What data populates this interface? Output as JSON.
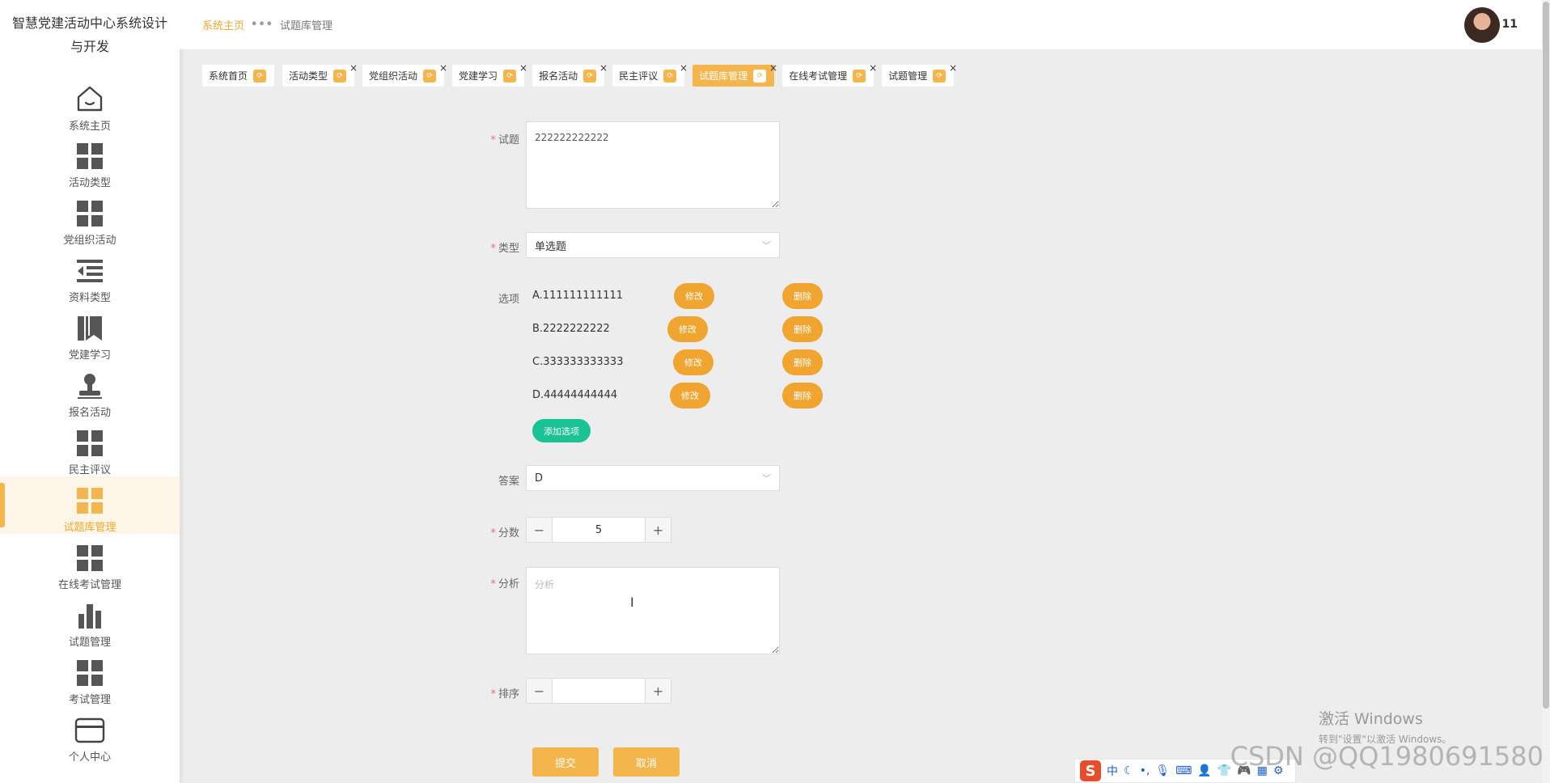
{
  "app": {
    "title": "智慧党建活动中心系统设计与开发"
  },
  "sidebar": {
    "items": [
      {
        "label": "系统主页",
        "icon": "home-icon"
      },
      {
        "label": "活动类型",
        "icon": "grid-icon"
      },
      {
        "label": "党组织活动",
        "icon": "grid-icon"
      },
      {
        "label": "资料类型",
        "icon": "indent-list-icon"
      },
      {
        "label": "党建学习",
        "icon": "book-icon"
      },
      {
        "label": "报名活动",
        "icon": "user-stamp-icon"
      },
      {
        "label": "民主评议",
        "icon": "grid-icon"
      },
      {
        "label": "试题库管理",
        "icon": "grid-icon",
        "active": true
      },
      {
        "label": "在线考试管理",
        "icon": "grid-icon"
      },
      {
        "label": "试题管理",
        "icon": "bar-chart-icon"
      },
      {
        "label": "考试管理",
        "icon": "grid-icon"
      },
      {
        "label": "个人中心",
        "icon": "card-icon"
      }
    ]
  },
  "header": {
    "breadcrumb_home": "系统主页",
    "breadcrumb_current": "试题库管理",
    "breadcrumb_sep": "•••",
    "user_name": "11"
  },
  "tabs": [
    {
      "label": "系统首页",
      "closable": false
    },
    {
      "label": "活动类型",
      "closable": true
    },
    {
      "label": "党组织活动",
      "closable": true
    },
    {
      "label": "党建学习",
      "closable": true
    },
    {
      "label": "报名活动",
      "closable": true
    },
    {
      "label": "民主评议",
      "closable": true
    },
    {
      "label": "试题库管理",
      "closable": true,
      "active": true
    },
    {
      "label": "在线考试管理",
      "closable": true
    },
    {
      "label": "试题管理",
      "closable": true
    }
  ],
  "form": {
    "question_label": "试题",
    "question_value": "222222222222",
    "type_label": "类型",
    "type_value": "单选题",
    "options_label": "选项",
    "options": [
      {
        "text": "A.111111111111"
      },
      {
        "text": "B.2222222222"
      },
      {
        "text": "C.333333333333"
      },
      {
        "text": "D.44444444444"
      }
    ],
    "edit_label": "修改",
    "delete_label": "删除",
    "add_option_label": "添加选项",
    "answer_label": "答案",
    "answer_value": "D",
    "score_label": "分数",
    "score_value": "5",
    "analysis_label": "分析",
    "analysis_placeholder": "分析",
    "order_label": "排序",
    "order_value": "",
    "submit_label": "提交",
    "cancel_label": "取消",
    "minus_symbol": "−",
    "plus_symbol": "+"
  },
  "watermark": {
    "activate_title": "激活 Windows",
    "activate_sub": "转到\"设置\"以激活 Windows。",
    "csdn": "CSDN @QQ1980691580"
  },
  "ime": {
    "logo": "S",
    "mode": "中"
  },
  "colors": {
    "accent": "#f5b54d",
    "button_orange": "#f0a530",
    "button_green": "#19c394",
    "required": "#f56c6c"
  }
}
